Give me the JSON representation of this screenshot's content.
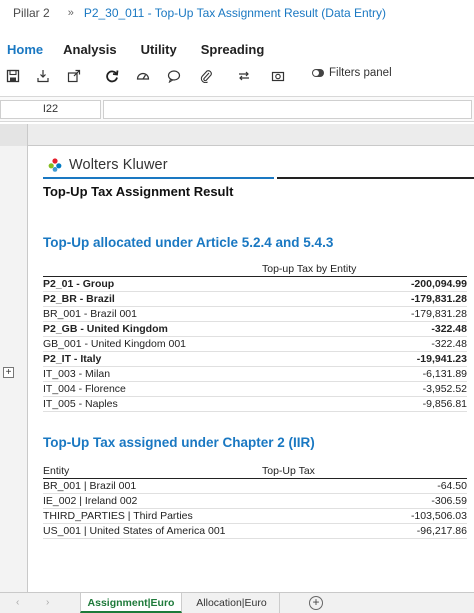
{
  "breadcrumb": {
    "root": "Pillar 2",
    "separator": "»",
    "current": "P2_30_011 - Top-Up Tax Assignment Result (Data Entry)"
  },
  "menu": {
    "items": [
      "Home",
      "Analysis",
      "Utility",
      "Spreading"
    ],
    "active": "Home"
  },
  "toolbar": {
    "icons": [
      "save-icon",
      "export-icon",
      "share-icon",
      "refresh-icon",
      "dashboard-icon",
      "comment-icon",
      "attachment-icon",
      "sync-icon",
      "camera-icon"
    ],
    "filters_label": "Filters panel"
  },
  "formula_bar": {
    "cell_ref": "I22",
    "value": ""
  },
  "report": {
    "logo_text": "Wolters Kluwer",
    "title": "Top-Up Tax Assignment Result",
    "section1": {
      "title": "Top-Up allocated under Article 5.2.4 and 5.4.3",
      "column_header": "Top-up Tax by Entity",
      "rows": [
        {
          "label": "P2_01 - Group",
          "value": "-200,094.99",
          "bold": true
        },
        {
          "label": "P2_BR - Brazil",
          "value": "-179,831.28",
          "bold": true
        },
        {
          "label": "BR_001 - Brazil 001",
          "value": "-179,831.28",
          "bold": false
        },
        {
          "label": "P2_GB - United Kingdom",
          "value": "-322.48",
          "bold": true
        },
        {
          "label": "GB_001 - United Kingdom 001",
          "value": "-322.48",
          "bold": false
        },
        {
          "label": "P2_IT - Italy",
          "value": "-19,941.23",
          "bold": true
        },
        {
          "label": "IT_003 - Milan",
          "value": "-6,131.89",
          "bold": false
        },
        {
          "label": "IT_004 - Florence",
          "value": "-3,952.52",
          "bold": false
        },
        {
          "label": "IT_005 - Naples",
          "value": "-9,856.81",
          "bold": false
        }
      ]
    },
    "section2": {
      "title": "Top-Up Tax assigned under Chapter 2 (IIR)",
      "column_entity": "Entity",
      "column_tax": "Top-Up Tax",
      "rows": [
        {
          "label": "BR_001 | Brazil 001",
          "value": "-64.50"
        },
        {
          "label": "IE_002 | Ireland 002",
          "value": "-306.59"
        },
        {
          "label": "THIRD_PARTIES | Third Parties",
          "value": "-103,506.03"
        },
        {
          "label": "US_001 | United States of America 001",
          "value": "-96,217.86"
        }
      ]
    }
  },
  "sheet_tabs": {
    "items": [
      "Assignment|Euro",
      "Allocation|Euro"
    ],
    "active": "Assignment|Euro"
  },
  "colors": {
    "accent_blue": "#1a78c2",
    "active_tab_green": "#1e7a3a"
  }
}
